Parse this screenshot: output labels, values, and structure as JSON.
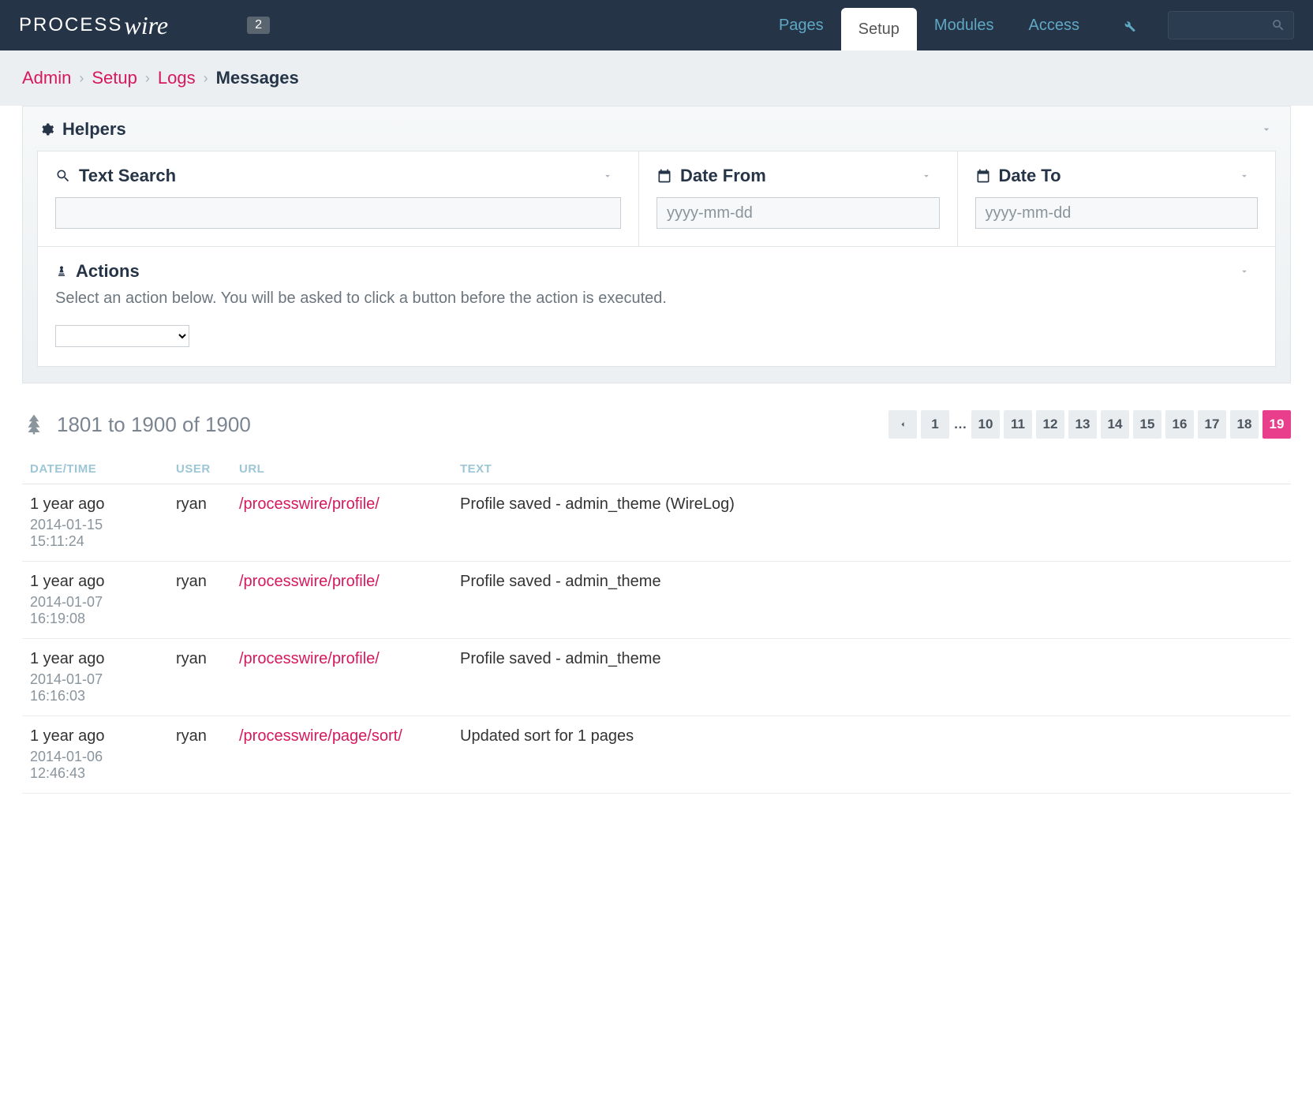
{
  "brand": {
    "part1": "PROCESS",
    "part2": "wire"
  },
  "notif_badge": "2",
  "nav": {
    "pages": "Pages",
    "setup": "Setup",
    "modules": "Modules",
    "access": "Access"
  },
  "breadcrumb": {
    "admin": "Admin",
    "setup": "Setup",
    "logs": "Logs",
    "current": "Messages"
  },
  "helpers": {
    "title": "Helpers",
    "text_search": "Text Search",
    "date_from": "Date From",
    "date_to": "Date To",
    "date_placeholder": "yyyy-mm-dd",
    "actions_title": "Actions",
    "actions_desc": "Select an action below. You will be asked to click a button before the action is executed."
  },
  "count": "1801 to 1900 of 1900",
  "pager": {
    "pages": [
      "10",
      "11",
      "12",
      "13",
      "14",
      "15",
      "16",
      "17",
      "18",
      "19"
    ],
    "first": "1",
    "active": "19"
  },
  "table": {
    "headers": {
      "dt": "DATE/TIME",
      "user": "USER",
      "url": "URL",
      "text": "TEXT"
    },
    "rows": [
      {
        "rel": "1 year ago",
        "abs": "2014-01-15 15:11:24",
        "user": "ryan",
        "url": "/processwire/profile/",
        "text": "Profile saved - admin_theme (WireLog)"
      },
      {
        "rel": "1 year ago",
        "abs": "2014-01-07 16:19:08",
        "user": "ryan",
        "url": "/processwire/profile/",
        "text": "Profile saved - admin_theme"
      },
      {
        "rel": "1 year ago",
        "abs": "2014-01-07 16:16:03",
        "user": "ryan",
        "url": "/processwire/profile/",
        "text": "Profile saved - admin_theme"
      },
      {
        "rel": "1 year ago",
        "abs": "2014-01-06 12:46:43",
        "user": "ryan",
        "url": "/processwire/page/sort/",
        "text": "Updated sort for 1 pages"
      }
    ]
  }
}
